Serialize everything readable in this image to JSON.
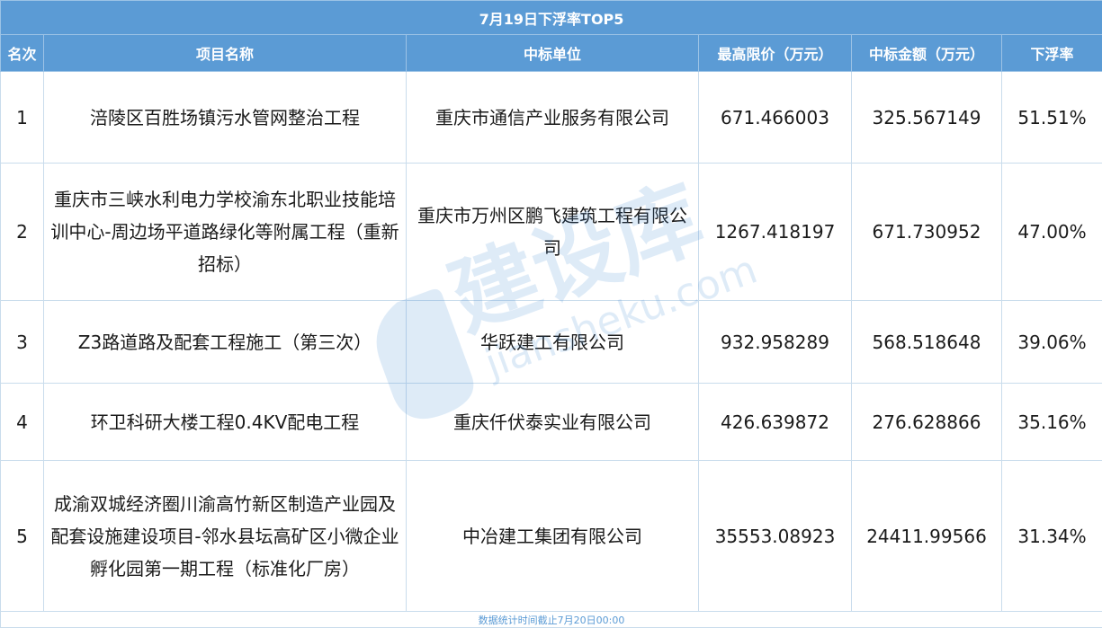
{
  "title": "7月19日下浮率TOP5",
  "headers": {
    "rank": "名次",
    "project": "项目名称",
    "winner": "中标单位",
    "max_price": "最高限价（万元）",
    "bid_amount": "中标金额（万元）",
    "discount": "下浮率"
  },
  "rows": [
    {
      "rank": "1",
      "project": "涪陵区百胜场镇污水管网整治工程",
      "winner": "重庆市通信产业服务有限公司",
      "max_price": "671.466003",
      "bid_amount": "325.567149",
      "discount": "51.51%"
    },
    {
      "rank": "2",
      "project": "重庆市三峡水利电力学校渝东北职业技能培训中心-周边场平道路绿化等附属工程（重新招标）",
      "winner": "重庆市万州区鹏飞建筑工程有限公司",
      "max_price": "1267.418197",
      "bid_amount": "671.730952",
      "discount": "47.00%"
    },
    {
      "rank": "3",
      "project": "Z3路道路及配套工程施工（第三次）",
      "winner": "华跃建工有限公司",
      "max_price": "932.958289",
      "bid_amount": "568.518648",
      "discount": "39.06%"
    },
    {
      "rank": "4",
      "project": "环卫科研大楼工程0.4KV配电工程",
      "winner": "重庆仟伏泰实业有限公司",
      "max_price": "426.639872",
      "bid_amount": "276.628866",
      "discount": "35.16%"
    },
    {
      "rank": "5",
      "project": "成渝双城经济圈川渝高竹新区制造产业园及配套设施建设项目-邻水县坛高矿区小微企业孵化园第一期工程（标准化厂房）",
      "winner": "中冶建工集团有限公司",
      "max_price": "35553.08923",
      "bid_amount": "24411.99566",
      "discount": "31.34%"
    }
  ],
  "footer": "数据统计时间截止7月20日00:00",
  "watermark": {
    "brand": "建设库",
    "domain": "jiansheku.com"
  },
  "colors": {
    "header_bg": "#5b9bd5",
    "header_text": "#ffffff",
    "grid": "#c9dcec",
    "footer_text": "#5b9bd5"
  }
}
